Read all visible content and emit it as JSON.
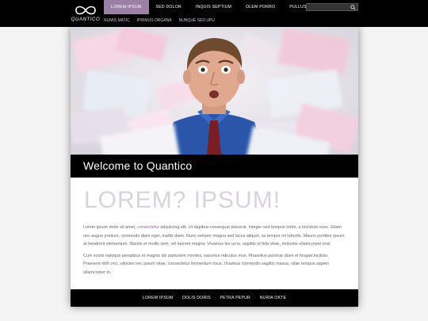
{
  "header": {
    "logo_text": "QUANTICO",
    "nav_primary": [
      {
        "label": "LOREM IPSUM",
        "active": true
      },
      {
        "label": "SED DOLOR",
        "active": false
      },
      {
        "label": "INQUIS SEPTIUM",
        "active": false
      },
      {
        "label": "OLEM PORRO",
        "active": false
      },
      {
        "label": "PULLUS IMPOUS",
        "active": false
      }
    ],
    "nav_secondary": [
      {
        "label": "NUMIS MATIC"
      },
      {
        "label": "IPRIMUS ORGANA"
      },
      {
        "label": "NUNQUE SED UPU"
      }
    ],
    "search": {
      "placeholder": "",
      "value": ""
    },
    "accent_color": "#9c7fa4"
  },
  "hero": {
    "icon": "photo-icon"
  },
  "welcome": {
    "title": "Welcome to Quantico"
  },
  "main": {
    "headline": "LOREM? IPSUM!",
    "para1_start": "Lorem ipsum dolor sit amet, ",
    "para1_link": "consectetur",
    "para1_rest": " adipiscing elit. Ut dapibus consequat placerat. Integer sed tempus tortor, a tincidunt nunc. Etiam nec augue pretium, commodo diam eget, mattis diam. Nunc semper magna sed lacus aliquet, ac tempor mi lobortis. Mauris porttitor ipsum at hendrerit elementum. Mauris et mollis sem, vel laoreet magna. Vivamus leo urna, sagittis ut felis vitae, molestie ullamcorper erat.",
    "para2": "Cum sociis natoque penatibus et magnis dis parturient montes, nascetur ridiculus mus. Phasellus pulvinar diam et feugiat facilisis. Praesent nibh orci, ultricies nec ipsum vitae, consectetur fermentum risus. Vivamus commodo sagittis massa, vitae tempus sapien ullamcorper in."
  },
  "footer": {
    "links": [
      "LOREM IPSUM",
      "DOLIS DORIS",
      "PETRA PEPUR",
      "NURIA OKTE"
    ],
    "separator": "·"
  }
}
